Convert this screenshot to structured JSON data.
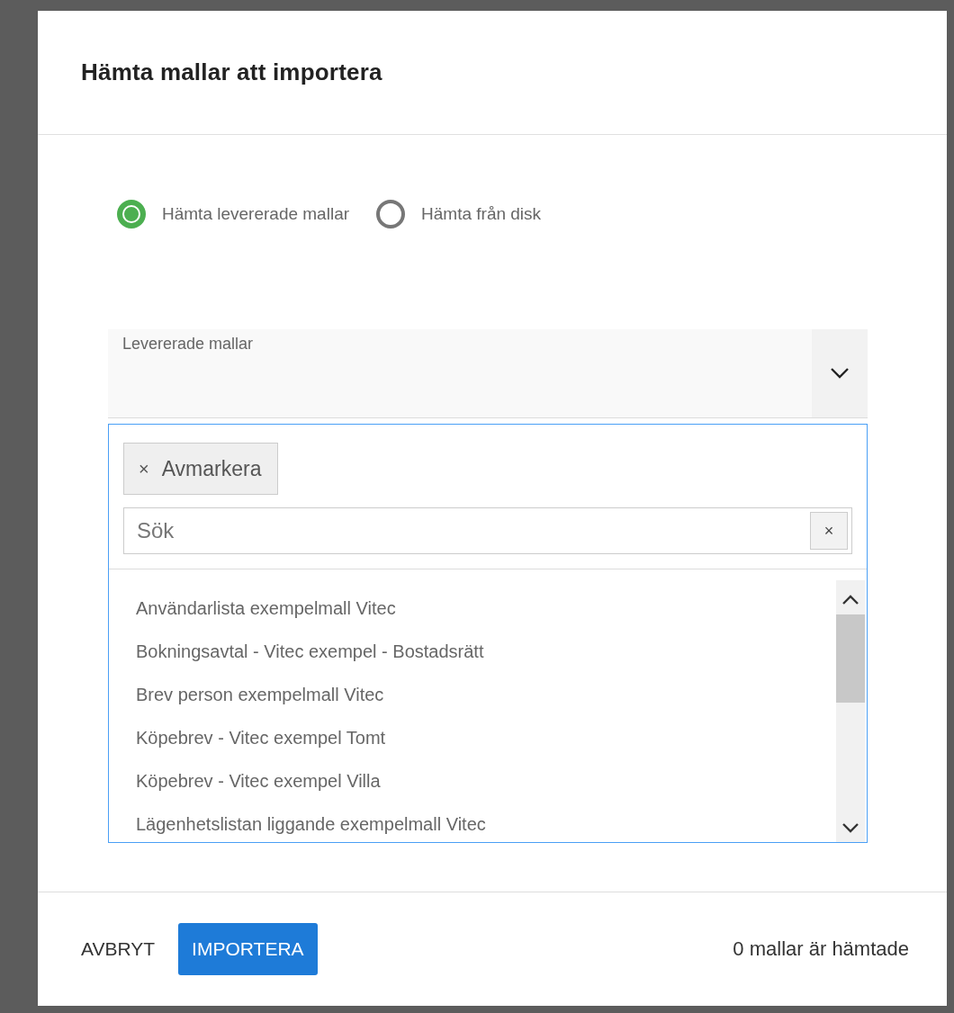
{
  "dialog": {
    "title": "Hämta mallar att importera"
  },
  "source_options": [
    {
      "label": "Hämta levererade mallar",
      "selected": true
    },
    {
      "label": "Hämta från disk",
      "selected": false
    }
  ],
  "dropdown": {
    "label": "Levererade mallar",
    "expanded": true
  },
  "panel": {
    "deselect_chip": {
      "icon": "×",
      "label": "Avmarkera"
    },
    "search": {
      "placeholder": "Sök",
      "clear": "×"
    },
    "items": [
      "Användarlista exempelmall Vitec",
      "Bokningsavtal - Vitec exempel - Bostadsrätt",
      "Brev person exempelmall Vitec",
      "Köpebrev - Vitec exempel Tomt",
      "Köpebrev - Vitec exempel Villa",
      "Lägenhetslistan liggande exempelmall Vitec"
    ]
  },
  "footer": {
    "cancel": "AVBRYT",
    "import": "IMPORTERA",
    "status": "0 mallar är hämtade"
  }
}
